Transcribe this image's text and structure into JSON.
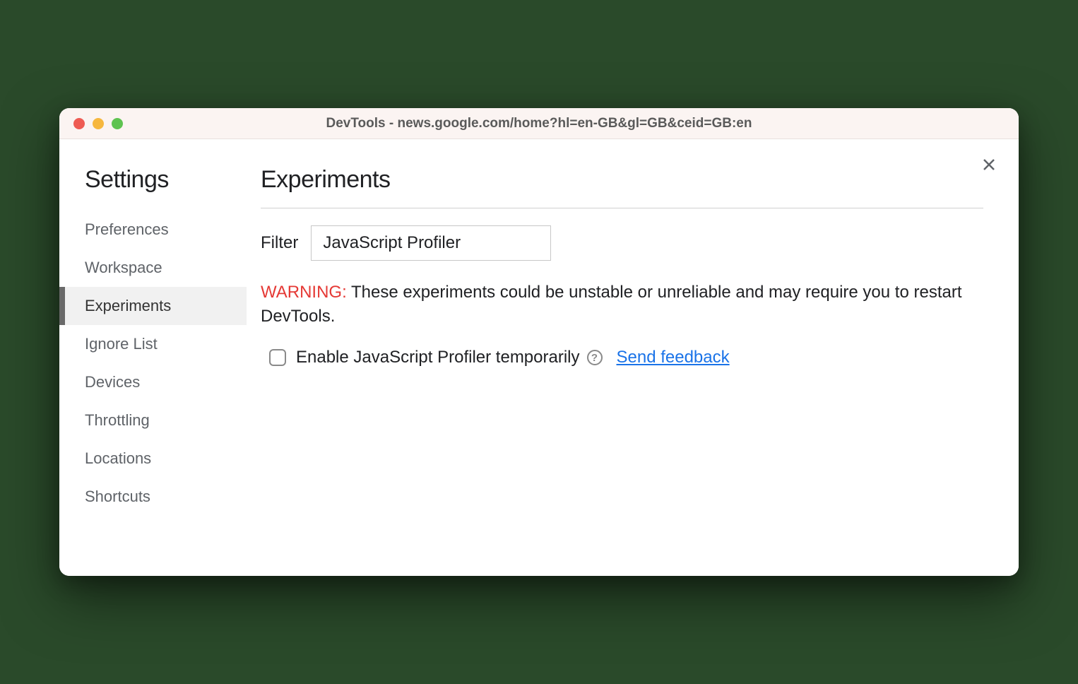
{
  "window": {
    "title": "DevTools - news.google.com/home?hl=en-GB&gl=GB&ceid=GB:en"
  },
  "sidebar": {
    "title": "Settings",
    "items": [
      {
        "label": "Preferences",
        "active": false
      },
      {
        "label": "Workspace",
        "active": false
      },
      {
        "label": "Experiments",
        "active": true
      },
      {
        "label": "Ignore List",
        "active": false
      },
      {
        "label": "Devices",
        "active": false
      },
      {
        "label": "Throttling",
        "active": false
      },
      {
        "label": "Locations",
        "active": false
      },
      {
        "label": "Shortcuts",
        "active": false
      }
    ]
  },
  "main": {
    "title": "Experiments",
    "filter_label": "Filter",
    "filter_value": "JavaScript Profiler",
    "warning_prefix": "WARNING:",
    "warning_text": " These experiments could be unstable or unreliable and may require you to restart DevTools.",
    "experiment": {
      "checked": false,
      "label": "Enable JavaScript Profiler temporarily",
      "help_symbol": "?",
      "feedback_link": "Send feedback"
    }
  }
}
